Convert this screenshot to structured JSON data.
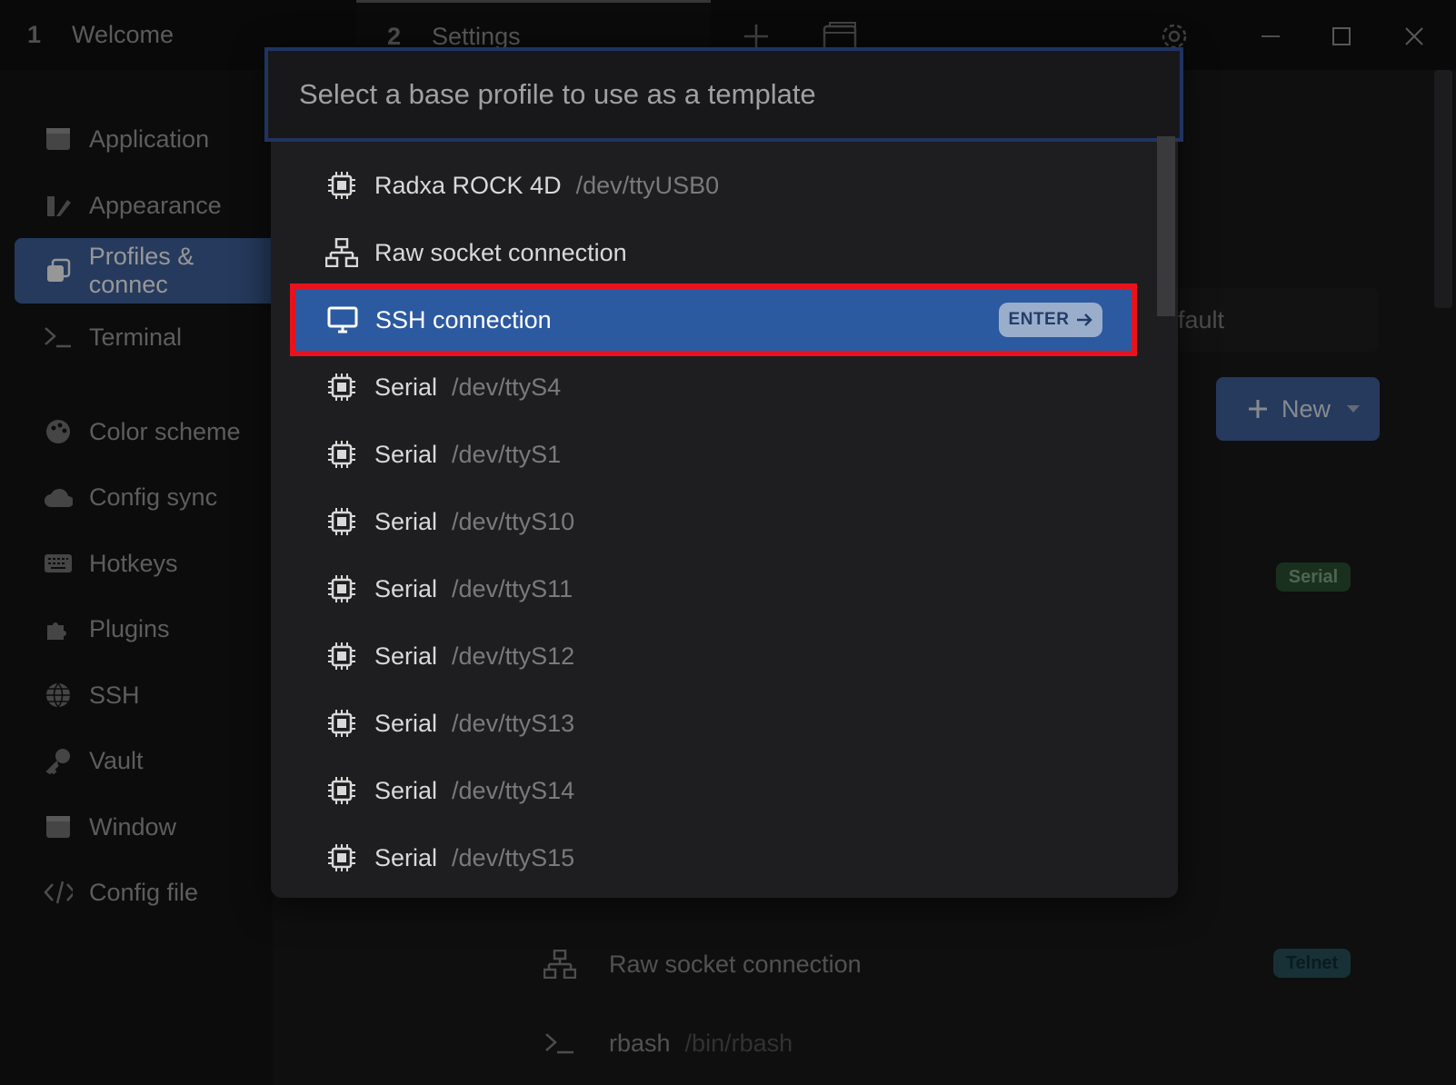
{
  "titlebar": {
    "tabs": [
      {
        "num": "1",
        "label": "Welcome"
      },
      {
        "num": "2",
        "label": "Settings"
      }
    ]
  },
  "sidebar": {
    "items": [
      {
        "label": "Application",
        "icon": "window-icon"
      },
      {
        "label": "Appearance",
        "icon": "paint-icon"
      },
      {
        "label": "Profiles & connections",
        "visible_label": "Profiles & connec",
        "icon": "profiles-icon",
        "active": true
      },
      {
        "label": "Terminal",
        "icon": "terminal-icon"
      },
      {
        "label": "Color scheme",
        "icon": "palette-icon"
      },
      {
        "label": "Config sync",
        "icon": "cloud-icon"
      },
      {
        "label": "Hotkeys",
        "icon": "keyboard-icon"
      },
      {
        "label": "Plugins",
        "icon": "puzzle-icon"
      },
      {
        "label": "SSH",
        "icon": "globe-icon"
      },
      {
        "label": "Vault",
        "icon": "key-icon"
      },
      {
        "label": "Window",
        "icon": "window-icon"
      },
      {
        "label": "Config file",
        "icon": "code-icon"
      }
    ]
  },
  "background": {
    "field_text": "fault",
    "new_button": "New",
    "badge_serial": "Serial",
    "badge_telnet": "Telnet",
    "rows": [
      {
        "label": "Raw socket connection",
        "sub": ""
      },
      {
        "label": "rbash",
        "sub": "/bin/rbash"
      }
    ]
  },
  "modal": {
    "placeholder": "Select a base profile to use as a template",
    "enter_label": "ENTER",
    "items": [
      {
        "label": "Radxa ROCK 4D",
        "sub": "/dev/ttyUSB0",
        "icon": "chip-icon"
      },
      {
        "label": "Raw socket connection",
        "sub": "",
        "icon": "network-icon"
      },
      {
        "label": "SSH connection",
        "sub": "",
        "icon": "desktop-icon",
        "selected": true
      },
      {
        "label": "Serial",
        "sub": "/dev/ttyS4",
        "icon": "chip-icon"
      },
      {
        "label": "Serial",
        "sub": "/dev/ttyS1",
        "icon": "chip-icon"
      },
      {
        "label": "Serial",
        "sub": "/dev/ttyS10",
        "icon": "chip-icon"
      },
      {
        "label": "Serial",
        "sub": "/dev/ttyS11",
        "icon": "chip-icon"
      },
      {
        "label": "Serial",
        "sub": "/dev/ttyS12",
        "icon": "chip-icon"
      },
      {
        "label": "Serial",
        "sub": "/dev/ttyS13",
        "icon": "chip-icon"
      },
      {
        "label": "Serial",
        "sub": "/dev/ttyS14",
        "icon": "chip-icon"
      },
      {
        "label": "Serial",
        "sub": "/dev/ttyS15",
        "icon": "chip-icon"
      }
    ]
  },
  "colors": {
    "accent": "#2c5aa0",
    "highlight_border": "#e8121d"
  }
}
